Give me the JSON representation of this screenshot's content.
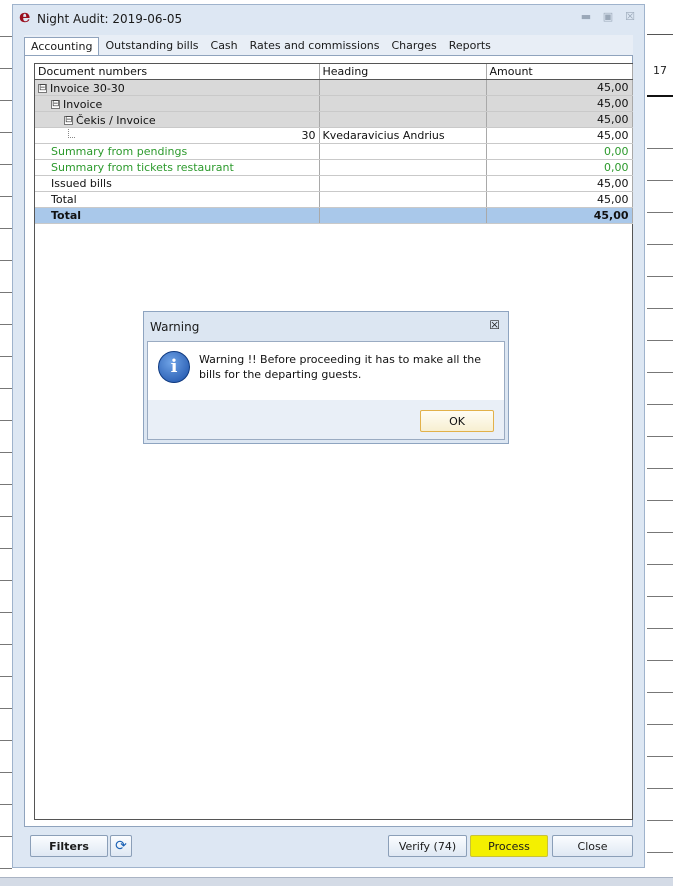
{
  "window": {
    "title": "Night Audit: 2019-06-05",
    "logo": "e"
  },
  "tabs": [
    {
      "label": "Accounting",
      "active": true
    },
    {
      "label": "Outstanding bills"
    },
    {
      "label": "Cash"
    },
    {
      "label": "Rates and commissions"
    },
    {
      "label": "Charges"
    },
    {
      "label": "Reports"
    }
  ],
  "grid": {
    "columns": [
      "Document numbers",
      "Heading",
      "Amount"
    ],
    "rows": [
      {
        "doc": "Invoice 30-30",
        "heading": "",
        "amount": "45,00",
        "kind": "group",
        "level": 0,
        "expander": "⊟"
      },
      {
        "doc": "Invoice",
        "heading": "",
        "amount": "45,00",
        "kind": "group",
        "level": 1,
        "expander": "⊟"
      },
      {
        "doc": "Čekis / Invoice",
        "heading": "",
        "amount": "45,00",
        "kind": "group",
        "level": 2,
        "expander": "⊟"
      },
      {
        "doc": "30",
        "heading": "Kvedaravicius Andrius",
        "amount": "45,00",
        "kind": "detail",
        "level": 3
      },
      {
        "doc": "Summary from pendings",
        "heading": "",
        "amount": "0,00",
        "kind": "green"
      },
      {
        "doc": "Summary from tickets restaurant",
        "heading": "",
        "amount": "0,00",
        "kind": "green"
      },
      {
        "doc": "Issued bills",
        "heading": "",
        "amount": "45,00",
        "kind": "plain"
      },
      {
        "doc": "Total",
        "heading": "",
        "amount": "45,00",
        "kind": "plain"
      },
      {
        "doc": "Total",
        "heading": "",
        "amount": "45,00",
        "kind": "total"
      }
    ]
  },
  "footer": {
    "filters_label": "Filters",
    "verify_label": "Verify (74)",
    "process_label": "Process",
    "close_label": "Close"
  },
  "dialog": {
    "title": "Warning",
    "message": "Warning !! Before proceeding it has to make all the bills for the departing guests.",
    "ok_label": "OK"
  },
  "background": {
    "right_number": "17"
  },
  "colors": {
    "total_row": "#a9c8ea",
    "green_text": "#2c9a2c",
    "process_highlight": "#f4f000",
    "logo": "#9a0f1e"
  }
}
